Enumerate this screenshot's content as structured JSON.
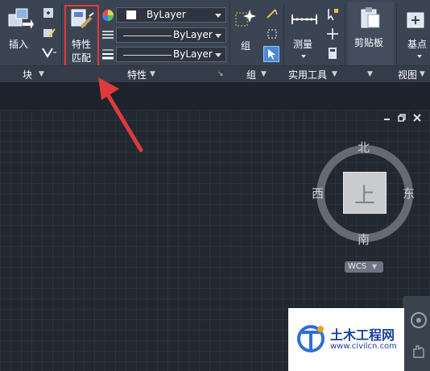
{
  "ribbon": {
    "insert_label": "插入",
    "match_label_line1": "特性",
    "match_label_line2": "匹配",
    "color_value": "ByLayer",
    "linetype_value": "ByLayer",
    "lineweight_value": "ByLayer",
    "group_label": "组",
    "measure_label": "测量",
    "clipboard_label": "剪贴板",
    "basepoint_label": "基点",
    "panels": {
      "block": "块",
      "properties": "特性",
      "group": "组",
      "utilities": "实用工具",
      "view": "视图"
    }
  },
  "viewcube": {
    "north": "北",
    "south": "南",
    "west": "西",
    "east": "东",
    "top": "上",
    "wcs": "WCS"
  },
  "watermark": {
    "name": "土木工程网",
    "url": "www.civilcn.com"
  },
  "colors": {
    "accent": "#e03a3a",
    "ribbon_bg": "#3b4453",
    "canvas_bg": "#212830"
  }
}
